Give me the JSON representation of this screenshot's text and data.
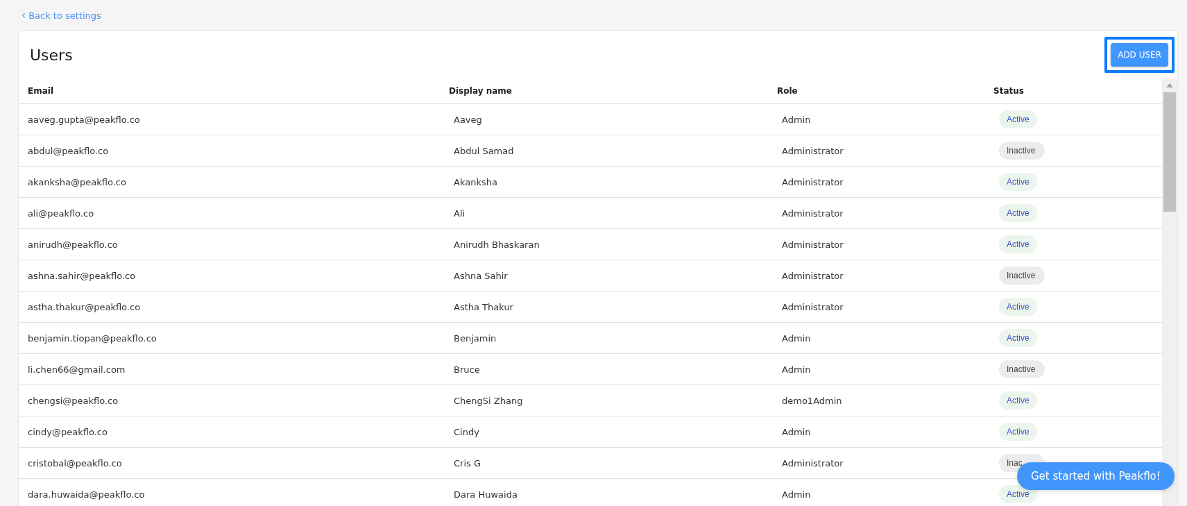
{
  "back_link": {
    "icon": "‹",
    "label": "Back to settings"
  },
  "title": "Users",
  "add_button": {
    "label": "ADD USER",
    "focused": true
  },
  "table": {
    "columns": [
      "Email",
      "Display name",
      "Role",
      "Status"
    ],
    "rows": [
      {
        "email": "aaveg.gupta@peakflo.co",
        "name": "Aaveg",
        "role": "Admin",
        "status": "Active",
        "active": true
      },
      {
        "email": "abdul@peakflo.co",
        "name": "Abdul Samad",
        "role": "Administrator",
        "status": "Inactive",
        "active": false
      },
      {
        "email": "akanksha@peakflo.co",
        "name": "Akanksha",
        "role": "Administrator",
        "status": "Active",
        "active": true
      },
      {
        "email": "ali@peakflo.co",
        "name": "Ali",
        "role": "Administrator",
        "status": "Active",
        "active": true
      },
      {
        "email": "anirudh@peakflo.co",
        "name": "Anirudh Bhaskaran",
        "role": "Administrator",
        "status": "Active",
        "active": true
      },
      {
        "email": "ashna.sahir@peakflo.co",
        "name": "Ashna Sahir",
        "role": "Administrator",
        "status": "Inactive",
        "active": false
      },
      {
        "email": "astha.thakur@peakflo.co",
        "name": "Astha Thakur",
        "role": "Administrator",
        "status": "Active",
        "active": true
      },
      {
        "email": "benjamin.tiopan@peakflo.co",
        "name": "Benjamin",
        "role": "Admin",
        "status": "Active",
        "active": true
      },
      {
        "email": "li.chen66@gmail.com",
        "name": "Bruce",
        "role": "Admin",
        "status": "Inactive",
        "active": false
      },
      {
        "email": "chengsi@peakflo.co",
        "name": "ChengSi Zhang",
        "role": "demo1Admin",
        "status": "Active",
        "active": true
      },
      {
        "email": "cindy@peakflo.co",
        "name": "Cindy",
        "role": "Admin",
        "status": "Active",
        "active": true
      },
      {
        "email": "cristobal@peakflo.co",
        "name": "Cris G",
        "role": "Administrator",
        "status": "Inac",
        "active": false
      },
      {
        "email": "dara.huwaida@peakflo.co",
        "name": "Dara Huwaida",
        "role": "Admin",
        "status": "Active",
        "active": true
      }
    ]
  },
  "chat_button": {
    "label": "Get started with Peakflo!"
  }
}
